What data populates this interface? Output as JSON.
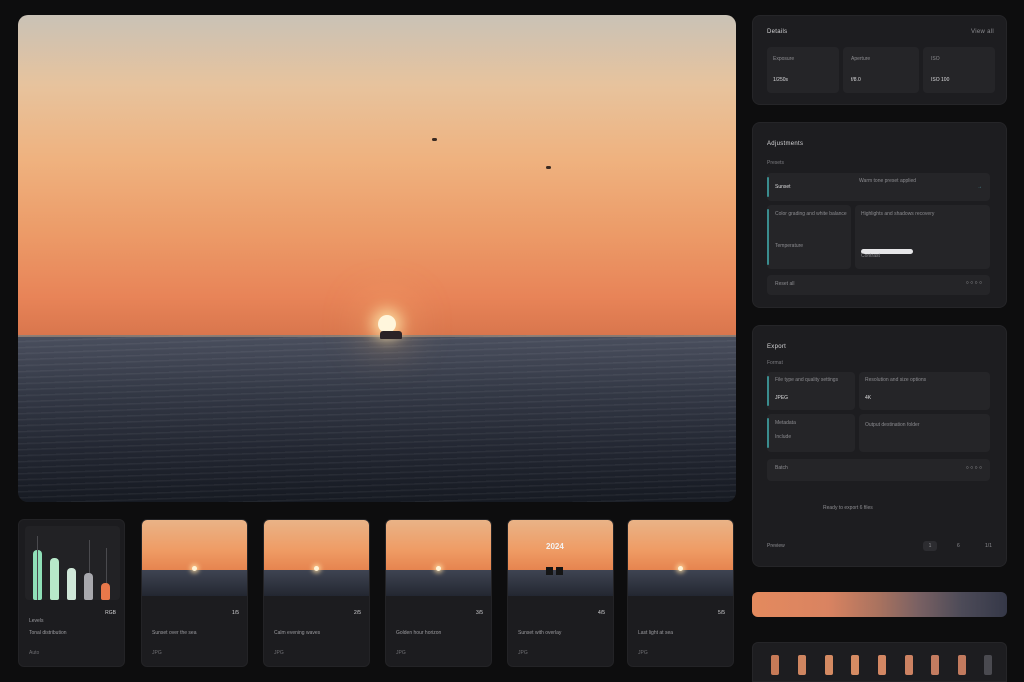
{
  "viewer": {
    "colors": {
      "sky_top": "#c9c2b6",
      "sky_horizon": "#d9764d",
      "sea": "#333845",
      "sun": "#fff6dc"
    }
  },
  "info_panel": {
    "title": "Details",
    "link": "View all",
    "cells": [
      {
        "label": "Exposure",
        "value": "1/250s"
      },
      {
        "label": "Aperture",
        "value": "f/8.0"
      },
      {
        "label": "ISO",
        "value": "ISO 100"
      }
    ]
  },
  "adjust_panel": {
    "title": "Adjustments",
    "subtitle": "Presets",
    "row1_left": "Sunset",
    "row1_right": "Warm tone preset applied",
    "row2_left_a": "Color grading and white balance",
    "row2_left_b": "Temperature",
    "row2_right_a": "Highlights and shadows recovery",
    "row2_right_b": "Contrast",
    "footer_label": "Reset all",
    "controls": [
      "○",
      "○",
      "○",
      "○"
    ]
  },
  "export_panel": {
    "title": "Export",
    "subtitle": "Format",
    "row1_left_a": "File type and quality settings",
    "row1_left_b": "JPEG",
    "row1_right_a": "Resolution and size options",
    "row1_right_b": "4K",
    "row2_left_a": "Metadata",
    "row2_left_b": "Include",
    "row2_right_a": "Output destination folder",
    "footer_label": "Batch",
    "controls": [
      "○",
      "○",
      "○",
      "○"
    ],
    "status": "Ready to export 6 files",
    "bottom_left": "Preview",
    "bottom_mid": "1",
    "bottom_r1": "6",
    "bottom_r2": "1/1"
  },
  "histogram": {
    "label": "Levels",
    "meta": "RGB",
    "line1": "Tonal distribution",
    "line2": "Auto",
    "bars": [
      {
        "color": "#8fe0b8",
        "level": 0.82
      },
      {
        "color": "#b7e8c9",
        "level": 0.68
      },
      {
        "color": "#cfe7d8",
        "level": 0.52
      },
      {
        "color": "#a8a8ad",
        "level": 0.44
      },
      {
        "color": "#e8784a",
        "level": 0.28
      }
    ]
  },
  "thumbnails": [
    {
      "meta": "1/5",
      "line1": "Sunset over the sea",
      "line2": "JPG"
    },
    {
      "meta": "2/5",
      "line1": "Calm evening waves",
      "line2": "JPG"
    },
    {
      "meta": "3/5",
      "line1": "Golden hour horizon",
      "line2": "JPG"
    },
    {
      "meta": "4/5",
      "line1": "Sunset with overlay",
      "line2": "JPG",
      "overlay": "2024"
    },
    {
      "meta": "5/5",
      "line1": "Last light at sea",
      "line2": "JPG"
    }
  ],
  "palette": {
    "swatches": [
      "#c77a57",
      "#cf8560",
      "#d48a62",
      "#d58b63",
      "#d38763",
      "#cc8262",
      "#c47c60",
      "#c27a5e",
      "#4a4a50"
    ]
  }
}
